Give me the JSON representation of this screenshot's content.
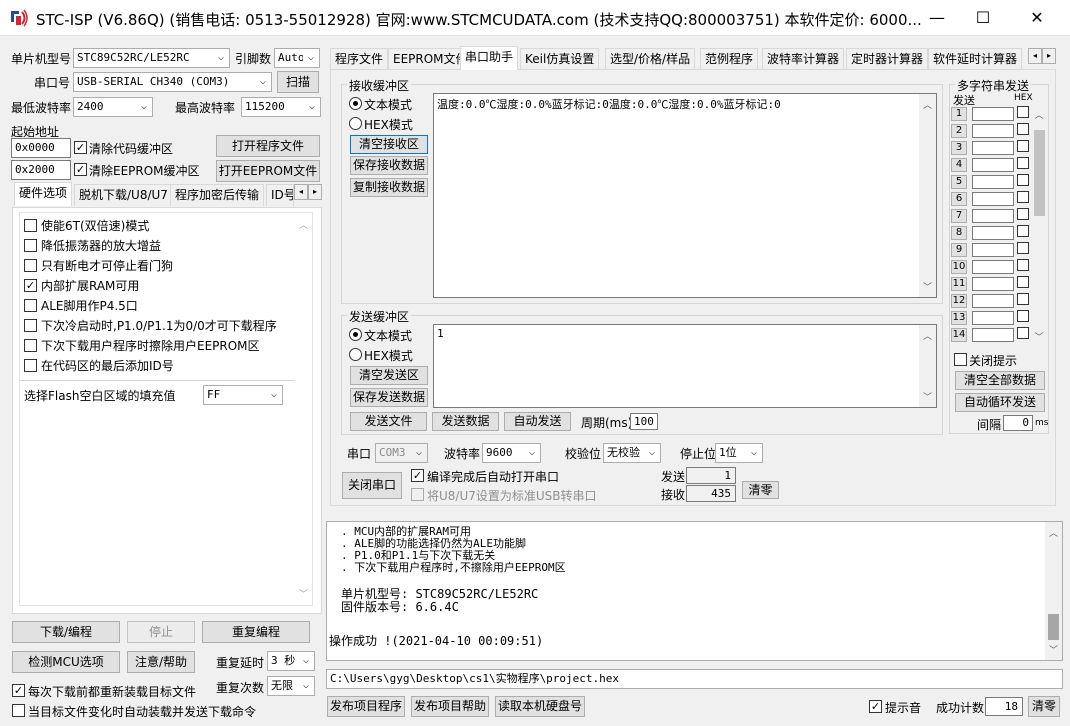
{
  "window": {
    "title": "STC-ISP (V6.86Q) (销售电话: 0513-55012928) 官网:www.STCMCUDATA.com  (技术支持QQ:800003751) 本软件定价: 6000...",
    "minimize": "—",
    "maximize": "☐",
    "close": "✕"
  },
  "left": {
    "mcu_label": "单片机型号",
    "mcu_value": "STC89C52RC/LE52RC",
    "pins_label": "引脚数",
    "pins_value": "Auto",
    "port_label": "串口号",
    "port_value": "USB-SERIAL CH340 (COM3)",
    "scan": "扫描",
    "min_baud_label": "最低波特率",
    "min_baud": "2400",
    "max_baud_label": "最高波特率",
    "max_baud": "115200",
    "start_addr_label": "起始地址",
    "addr1": "0x0000",
    "clear_code": "清除代码缓冲区",
    "open_prog": "打开程序文件",
    "addr2": "0x2000",
    "clear_eeprom": "清除EEPROM缓冲区",
    "open_eeprom": "打开EEPROM文件",
    "tabs": [
      "硬件选项",
      "脱机下载/U8/U7",
      "程序加密后传输",
      "ID号"
    ],
    "options": [
      {
        "label": "使能6T(双倍速)模式",
        "checked": false
      },
      {
        "label": "降低振荡器的放大增益",
        "checked": false
      },
      {
        "label": "只有断电才可停止看门狗",
        "checked": false
      },
      {
        "label": "内部扩展RAM可用",
        "checked": true
      },
      {
        "label": "ALE脚用作P4.5口",
        "checked": false
      },
      {
        "label": "下次冷启动时,P1.0/P1.1为0/0才可下载程序",
        "checked": false
      },
      {
        "label": "下次下载用户程序时擦除用户EEPROM区",
        "checked": false
      },
      {
        "label": "在代码区的最后添加ID号",
        "checked": false
      }
    ],
    "fill_label": "选择Flash空白区域的填充值",
    "fill_value": "FF",
    "download": "下载/编程",
    "stop": "停止",
    "reprogram": "重复编程",
    "check_mcu": "检测MCU选项",
    "help": "注意/帮助",
    "repeat_delay_label": "重复延时",
    "repeat_delay": "3 秒",
    "repeat_count_label": "重复次数",
    "repeat_count": "无限",
    "reload_before": "每次下载前都重新装载目标文件",
    "auto_load": "当目标文件变化时自动装载并发送下载命令"
  },
  "right": {
    "tabs": [
      "程序文件",
      "EEPROM文件",
      "串口助手",
      "Keil仿真设置",
      "选型/价格/样品",
      "范例程序",
      "波特率计算器",
      "定时器计算器",
      "软件延时计算器"
    ],
    "recv_group": "接收缓冲区",
    "text_mode": "文本模式",
    "hex_mode": "HEX模式",
    "clear_recv": "清空接收区",
    "save_recv": "保存接收数据",
    "copy_recv": "复制接收数据",
    "recv_content": "温度:0.0℃湿度:0.0%蓝牙标记:0温度:0.0℃湿度:0.0%蓝牙标记:0",
    "send_group": "发送缓冲区",
    "clear_send": "清空发送区",
    "save_send": "保存发送数据",
    "send_content": "1",
    "send_file": "发送文件",
    "send_data": "发送数据",
    "auto_send": "自动发送",
    "period_label": "周期(ms)",
    "period": "100",
    "serial_label": "串口",
    "serial_value": "COM3",
    "baud_label": "波特率",
    "baud_value": "9600",
    "parity_label": "校验位",
    "parity_value": "无校验",
    "stop_label": "停止位",
    "stop_value": "1位",
    "close_port": "关闭串口",
    "auto_open": "编译完成后自动打开串口",
    "u8_std": "将U8/U7设置为标准USB转串口",
    "sent_label": "发送",
    "sent": "1",
    "recv_label": "接收",
    "recv": "435",
    "clear_count": "清零",
    "multi_title": "多字符串发送",
    "multi_send": "发送",
    "multi_hex": "HEX",
    "multi_rows": [
      "1",
      "2",
      "3",
      "4",
      "5",
      "6",
      "7",
      "8",
      "9",
      "10",
      "11",
      "12",
      "13",
      "14"
    ],
    "close_tip": "关闭提示",
    "clear_all": "清空全部数据",
    "auto_loop": "自动循环发送",
    "interval_label": "间隔",
    "interval": "0",
    "interval_unit": "ms"
  },
  "log": {
    "lines": [
      ". MCU内部的扩展RAM可用",
      ". ALE脚的功能选择仍然为ALE功能脚",
      ". P1.0和P1.1与下次下载无关",
      ". 下次下载用户程序时,不擦除用户EEPROM区"
    ],
    "mcu_model": "单片机型号: STC89C52RC/LE52RC",
    "firmware": "固件版本号: 6.6.4C",
    "success": "操作成功 !(2021-04-10 00:09:51)"
  },
  "bottom": {
    "path": "C:\\Users\\gyg\\Desktop\\cs1\\实物程序\\project.hex",
    "publish_prog": "发布项目程序",
    "publish_help": "发布项目帮助",
    "read_disk": "读取本机硬盘号",
    "beep": "提示音",
    "success_count_label": "成功计数",
    "success_count": "18",
    "clear": "清零"
  },
  "colors": {
    "accent": "#0078d7",
    "logo_red": "#d9232d",
    "logo_blue": "#1f4aa8"
  }
}
